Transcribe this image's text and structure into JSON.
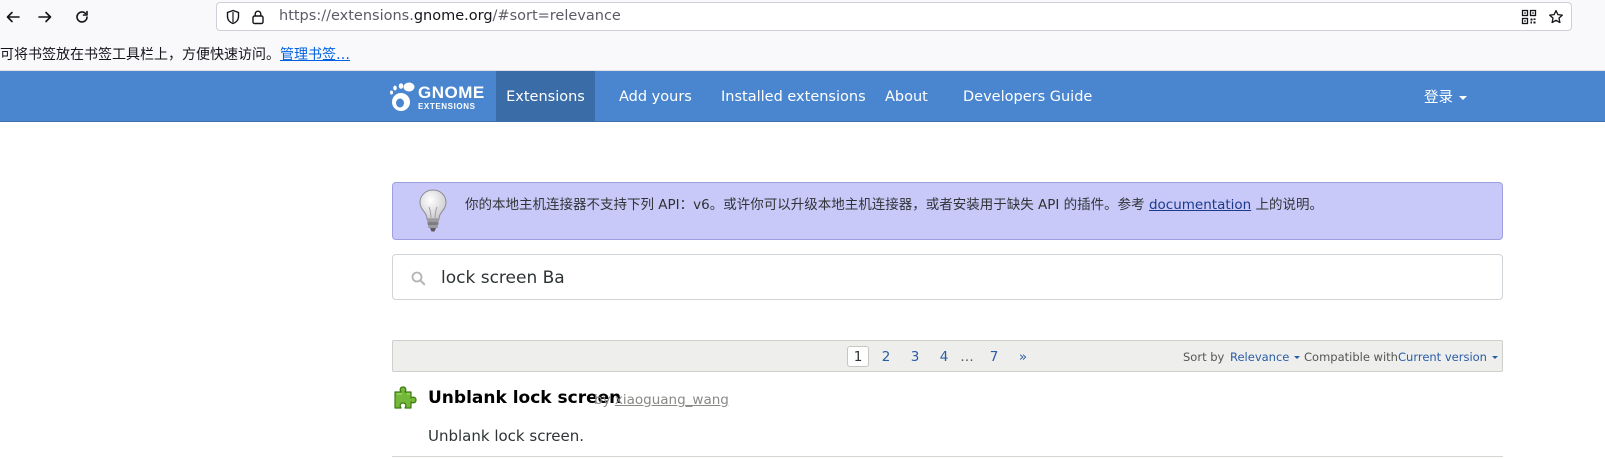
{
  "browser": {
    "url_prefix": "https://extensions.",
    "url_domain": "gnome.org",
    "url_suffix": "/#sort=relevance"
  },
  "bookmarks_bar": {
    "message": "可将书签放在书签工具栏上，方便快速访问。",
    "manage_link": "管理书签…"
  },
  "header": {
    "logo_title": "GNOME",
    "logo_subtitle": "EXTENSIONS",
    "nav": [
      {
        "label": "Extensions",
        "active": true
      },
      {
        "label": "Add yours",
        "active": false
      },
      {
        "label": "Installed extensions",
        "active": false
      },
      {
        "label": "About",
        "active": false
      },
      {
        "label": "Developers Guide",
        "active": false
      }
    ],
    "login_label": "登录"
  },
  "notice": {
    "text_before": "你的本地主机连接器不支持下列 API：v6。或许你可以升级本地主机连接器，或者安装用于缺失 API 的插件。参考 ",
    "link": "documentation",
    "text_after": " 上的说明。"
  },
  "search": {
    "value": "lock screen Ba"
  },
  "pager": {
    "pages": [
      "1",
      "2",
      "3",
      "4",
      "…",
      "7",
      "»"
    ],
    "current_page": "1",
    "sort_by_label": "Sort by",
    "sort_by_value": "Relevance",
    "compatible_label": "Compatible with",
    "compatible_value": "Current version"
  },
  "results": [
    {
      "title": "Unblank lock screen",
      "by_label": "by",
      "author": "xiaoguang_wang",
      "description": "Unblank lock screen."
    }
  ]
}
